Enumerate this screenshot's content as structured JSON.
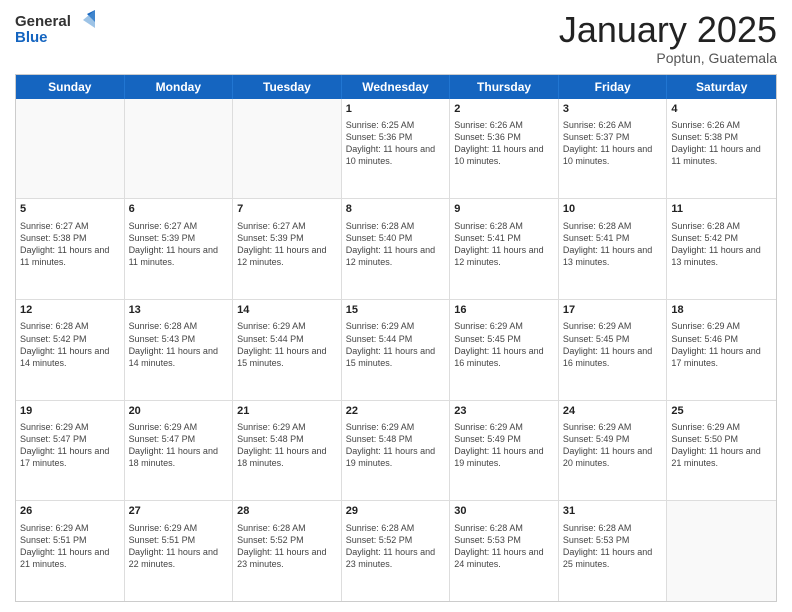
{
  "header": {
    "logo_line1": "General",
    "logo_line2": "Blue",
    "month_title": "January 2025",
    "location": "Poptun, Guatemala"
  },
  "weekdays": [
    "Sunday",
    "Monday",
    "Tuesday",
    "Wednesday",
    "Thursday",
    "Friday",
    "Saturday"
  ],
  "rows": [
    [
      {
        "day": "",
        "text": ""
      },
      {
        "day": "",
        "text": ""
      },
      {
        "day": "",
        "text": ""
      },
      {
        "day": "1",
        "text": "Sunrise: 6:25 AM\nSunset: 5:36 PM\nDaylight: 11 hours and 10 minutes."
      },
      {
        "day": "2",
        "text": "Sunrise: 6:26 AM\nSunset: 5:36 PM\nDaylight: 11 hours and 10 minutes."
      },
      {
        "day": "3",
        "text": "Sunrise: 6:26 AM\nSunset: 5:37 PM\nDaylight: 11 hours and 10 minutes."
      },
      {
        "day": "4",
        "text": "Sunrise: 6:26 AM\nSunset: 5:38 PM\nDaylight: 11 hours and 11 minutes."
      }
    ],
    [
      {
        "day": "5",
        "text": "Sunrise: 6:27 AM\nSunset: 5:38 PM\nDaylight: 11 hours and 11 minutes."
      },
      {
        "day": "6",
        "text": "Sunrise: 6:27 AM\nSunset: 5:39 PM\nDaylight: 11 hours and 11 minutes."
      },
      {
        "day": "7",
        "text": "Sunrise: 6:27 AM\nSunset: 5:39 PM\nDaylight: 11 hours and 12 minutes."
      },
      {
        "day": "8",
        "text": "Sunrise: 6:28 AM\nSunset: 5:40 PM\nDaylight: 11 hours and 12 minutes."
      },
      {
        "day": "9",
        "text": "Sunrise: 6:28 AM\nSunset: 5:41 PM\nDaylight: 11 hours and 12 minutes."
      },
      {
        "day": "10",
        "text": "Sunrise: 6:28 AM\nSunset: 5:41 PM\nDaylight: 11 hours and 13 minutes."
      },
      {
        "day": "11",
        "text": "Sunrise: 6:28 AM\nSunset: 5:42 PM\nDaylight: 11 hours and 13 minutes."
      }
    ],
    [
      {
        "day": "12",
        "text": "Sunrise: 6:28 AM\nSunset: 5:42 PM\nDaylight: 11 hours and 14 minutes."
      },
      {
        "day": "13",
        "text": "Sunrise: 6:28 AM\nSunset: 5:43 PM\nDaylight: 11 hours and 14 minutes."
      },
      {
        "day": "14",
        "text": "Sunrise: 6:29 AM\nSunset: 5:44 PM\nDaylight: 11 hours and 15 minutes."
      },
      {
        "day": "15",
        "text": "Sunrise: 6:29 AM\nSunset: 5:44 PM\nDaylight: 11 hours and 15 minutes."
      },
      {
        "day": "16",
        "text": "Sunrise: 6:29 AM\nSunset: 5:45 PM\nDaylight: 11 hours and 16 minutes."
      },
      {
        "day": "17",
        "text": "Sunrise: 6:29 AM\nSunset: 5:45 PM\nDaylight: 11 hours and 16 minutes."
      },
      {
        "day": "18",
        "text": "Sunrise: 6:29 AM\nSunset: 5:46 PM\nDaylight: 11 hours and 17 minutes."
      }
    ],
    [
      {
        "day": "19",
        "text": "Sunrise: 6:29 AM\nSunset: 5:47 PM\nDaylight: 11 hours and 17 minutes."
      },
      {
        "day": "20",
        "text": "Sunrise: 6:29 AM\nSunset: 5:47 PM\nDaylight: 11 hours and 18 minutes."
      },
      {
        "day": "21",
        "text": "Sunrise: 6:29 AM\nSunset: 5:48 PM\nDaylight: 11 hours and 18 minutes."
      },
      {
        "day": "22",
        "text": "Sunrise: 6:29 AM\nSunset: 5:48 PM\nDaylight: 11 hours and 19 minutes."
      },
      {
        "day": "23",
        "text": "Sunrise: 6:29 AM\nSunset: 5:49 PM\nDaylight: 11 hours and 19 minutes."
      },
      {
        "day": "24",
        "text": "Sunrise: 6:29 AM\nSunset: 5:49 PM\nDaylight: 11 hours and 20 minutes."
      },
      {
        "day": "25",
        "text": "Sunrise: 6:29 AM\nSunset: 5:50 PM\nDaylight: 11 hours and 21 minutes."
      }
    ],
    [
      {
        "day": "26",
        "text": "Sunrise: 6:29 AM\nSunset: 5:51 PM\nDaylight: 11 hours and 21 minutes."
      },
      {
        "day": "27",
        "text": "Sunrise: 6:29 AM\nSunset: 5:51 PM\nDaylight: 11 hours and 22 minutes."
      },
      {
        "day": "28",
        "text": "Sunrise: 6:28 AM\nSunset: 5:52 PM\nDaylight: 11 hours and 23 minutes."
      },
      {
        "day": "29",
        "text": "Sunrise: 6:28 AM\nSunset: 5:52 PM\nDaylight: 11 hours and 23 minutes."
      },
      {
        "day": "30",
        "text": "Sunrise: 6:28 AM\nSunset: 5:53 PM\nDaylight: 11 hours and 24 minutes."
      },
      {
        "day": "31",
        "text": "Sunrise: 6:28 AM\nSunset: 5:53 PM\nDaylight: 11 hours and 25 minutes."
      },
      {
        "day": "",
        "text": ""
      }
    ]
  ]
}
